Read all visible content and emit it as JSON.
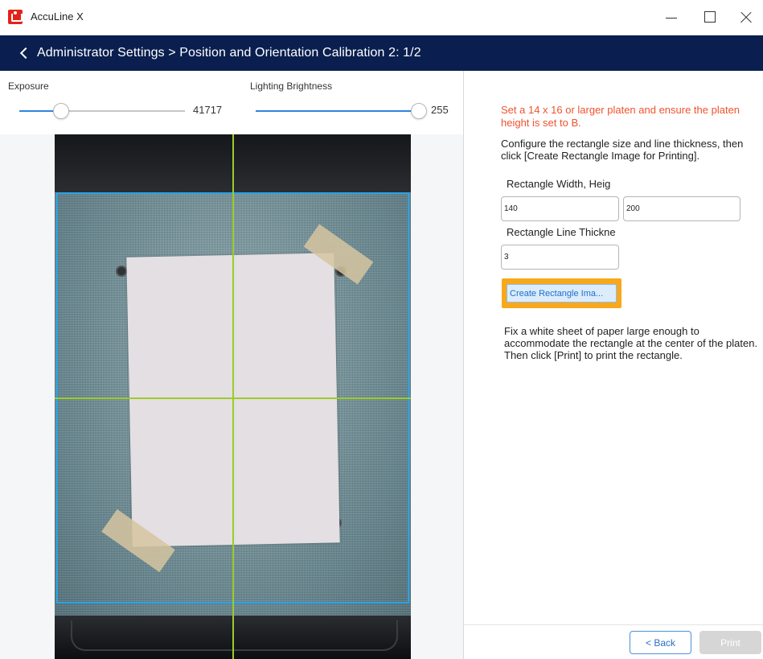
{
  "window": {
    "app_title": "AccuLine X",
    "app_icon": "acculine-logo-icon",
    "controls": [
      "minimize-icon",
      "maximize-icon",
      "close-icon"
    ]
  },
  "header": {
    "title": "Administrator Settings > Position and Orientation Calibration 2: 1/2",
    "background": "#0a1f4f"
  },
  "controls": {
    "exposure": {
      "label": "Exposure",
      "value": "41717",
      "level": 0.25
    },
    "brightness": {
      "label": "Lighting Brightness",
      "value": "255",
      "level": 1.0
    }
  },
  "right_panel": {
    "warning": "Set a 14 x 16 or larger platen and ensure the platen height is set to B.",
    "instructions": "Configure the rectangle size and line thickness, then click [Create Rectangle Image for Printing].",
    "size_label": "Rectangle Width, Heig",
    "width_value": "140",
    "height_value": "200",
    "thickness_label": "Rectangle Line Thickne",
    "thickness_value": "3",
    "create_button": "Create Rectangle Ima...",
    "fix_instructions": "Fix a white sheet of paper large enough to accommodate the rectangle at the center of the platen. Then click [Print] to print the rectangle."
  },
  "footer": {
    "back_label": "< Back",
    "print_label": "Print"
  },
  "colors": {
    "accent": "#2e86de",
    "warning": "#f0532d",
    "highlight": "#f8a81b",
    "guide_line": "#9ccc2a",
    "detect_box": "#2aa3e6"
  }
}
